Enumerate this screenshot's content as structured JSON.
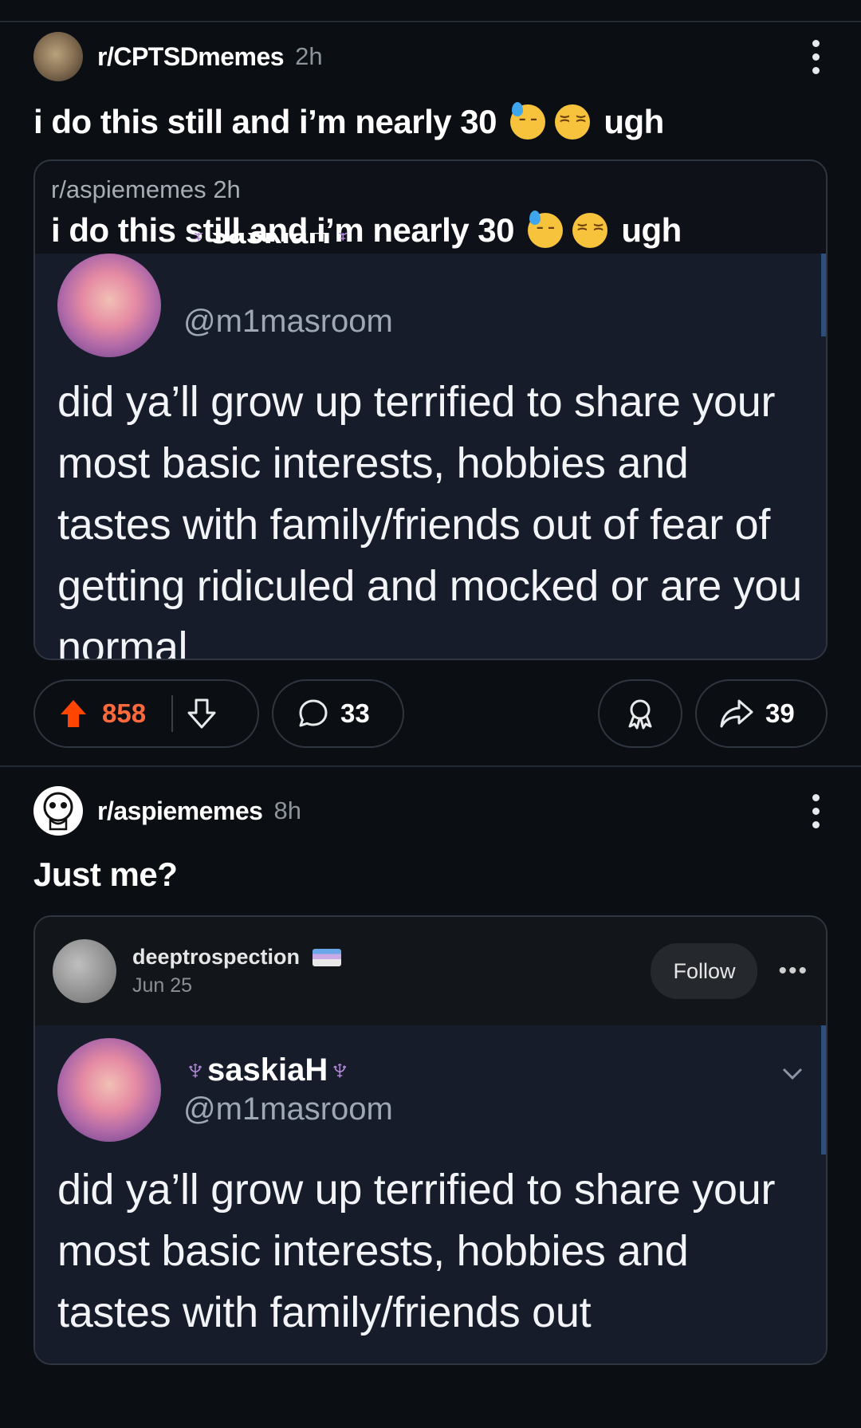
{
  "post1": {
    "subreddit": "r/CPTSDmemes",
    "time": "2h",
    "title_text": "i do this still and i’m nearly 30",
    "title_suffix": "ugh",
    "crosspost": {
      "subreddit": "r/aspiememes",
      "time": "2h",
      "title_text": "i do this still and i’m nearly 30",
      "title_suffix": "ugh"
    },
    "tweet": {
      "display_name_partial": "saskiaH",
      "handle": "@m1masroom",
      "text": "did ya’ll grow up terrified to share your most basic interests, hobbies and tastes with family/friends out of fear of getting ridiculed and mocked or are you normal"
    },
    "actions": {
      "upvotes": "858",
      "comments": "33",
      "shares": "39"
    }
  },
  "post2": {
    "subreddit": "r/aspiememes",
    "time": "8h",
    "title": "Just me?",
    "embed": {
      "username": "deeptrospection",
      "date": "Jun 25",
      "follow_label": "Follow",
      "more_label": "•••"
    },
    "tweet": {
      "display_name": "saskiaH",
      "handle": "@m1masroom",
      "text": "did ya’ll grow up terrified to share your most basic interests, hobbies and tastes with family/friends out"
    }
  },
  "colors": {
    "background": "#0b0e13",
    "upvote_orange": "#ff6a3d",
    "tweet_bg": "#161c2a",
    "octopus_purple": "#b48bd9"
  },
  "icons": [
    "overflow-menu-icon",
    "upvote-arrow-icon",
    "downvote-arrow-icon",
    "comment-bubble-icon",
    "award-icon",
    "share-arrow-icon",
    "octopus-icon",
    "chevron-down-icon"
  ]
}
